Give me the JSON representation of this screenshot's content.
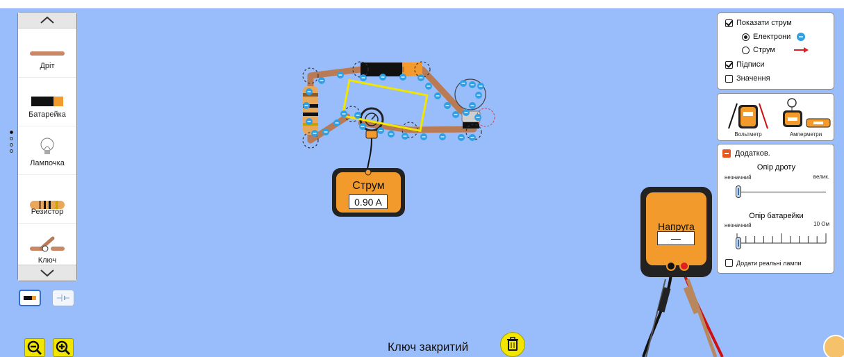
{
  "toolbox": {
    "items": [
      {
        "label": "Дріт",
        "icon": "wire-icon"
      },
      {
        "label": "Батарейка",
        "icon": "battery-icon"
      },
      {
        "label": "Лампочка",
        "icon": "light-bulb-icon"
      },
      {
        "label": "Резистор",
        "icon": "resistor-icon"
      },
      {
        "label": "Ключ",
        "icon": "switch-icon"
      }
    ]
  },
  "view_panel": {
    "show_current": {
      "label": "Показати струм",
      "checked": true
    },
    "electrons": {
      "label": "Електрони",
      "selected": true
    },
    "conventional": {
      "label": "Струм",
      "selected": false
    },
    "labels": {
      "label": "Підписи",
      "checked": true
    },
    "values": {
      "label": "Значення",
      "checked": false
    }
  },
  "tools_panel": {
    "voltmeter_label": "Вольтметр",
    "ammeter_label": "Амперметри"
  },
  "advanced_panel": {
    "title": "Додатков.",
    "wire_resistance": {
      "title": "Опір дроту",
      "min_label": "незначний",
      "max_label": "велик.",
      "value": 0
    },
    "battery_resistance": {
      "title": "Опір батарейки",
      "min_label": "незначний",
      "max_label": "10 Ом",
      "value": 0
    },
    "real_bulbs": {
      "label": "Додати реальні лампи",
      "checked": false
    }
  },
  "ammeter": {
    "title": "Струм",
    "reading": "0.90 A"
  },
  "voltmeter": {
    "title": "Напруга",
    "reading": "—"
  },
  "status_text": "Ключ закритий",
  "colors": {
    "background": "#99bdfb",
    "accent_yellow": "#f2e600",
    "meter_orange": "#f39a2c",
    "electron_blue": "#2fa0e6"
  }
}
